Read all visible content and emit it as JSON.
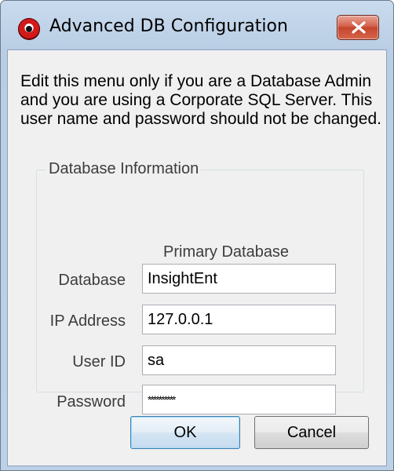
{
  "window": {
    "title": "Advanced DB Configuration"
  },
  "description": "Edit this menu only if you are a Database Admin and you are using a Corporate SQL Server.  This user name and password should not be changed.",
  "group": {
    "title": "Database Information",
    "column_header": "Primary Database",
    "fields": [
      {
        "label": "Database",
        "value": "InsightEnt"
      },
      {
        "label": "IP Address",
        "value": "127.0.0.1"
      },
      {
        "label": "User ID",
        "value": "sa"
      },
      {
        "label": "Password",
        "value": "**********"
      }
    ]
  },
  "buttons": {
    "ok": "OK",
    "cancel": "Cancel"
  },
  "icons": {
    "app": "eye-icon",
    "close": "close-icon"
  },
  "colors": {
    "title_bar": "#c9dbee",
    "close_button": "#c4452c",
    "client_background": "#f0f0f0"
  }
}
